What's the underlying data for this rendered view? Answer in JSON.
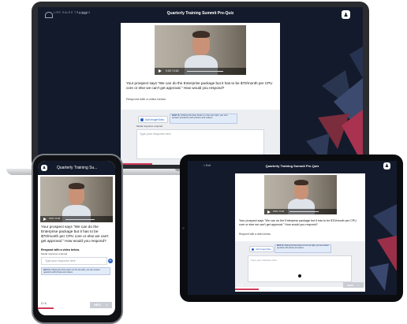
{
  "app": {
    "logo_text": "LIFE SALES TRAINING",
    "exit_label": "< Exit",
    "quiz_title": "Quarterly Training Summit Pre-Quiz",
    "quiz_title_short": "Quarterly Training Su..."
  },
  "video": {
    "time_laptop": "0:00 / 0:18",
    "time_phone": "0:00 / 0:18",
    "time_tablet": "0:00 / 0:18"
  },
  "question": {
    "text": "Your prospect says \"We can do the Enterprise package but it has to be $70/month per CPU core or else we can't get approval.\" How would you respond?",
    "respond_label": "Respond with a video below.",
    "respond_label_phone": "Respond with a video below.",
    "media_required": "Media response required"
  },
  "response": {
    "add_image_label": "Add Image/Video",
    "hint_bold": "Hint!",
    "hint_text": "By clicking the blue button on the top right, you can answer questions with photos and videos.",
    "placeholder": "Type your response here"
  },
  "footer": {
    "page_indicator": "2 / 4",
    "next_label": "NEXT",
    "next_arrow": ">",
    "progress": 0.5
  },
  "colors": {
    "navy": "#131a2b",
    "accent": "#d23b5b",
    "link_blue": "#2b62c4"
  },
  "icons": {
    "user": "user-icon",
    "play": "play-icon",
    "record": "record-icon",
    "upload": "upload-icon"
  }
}
